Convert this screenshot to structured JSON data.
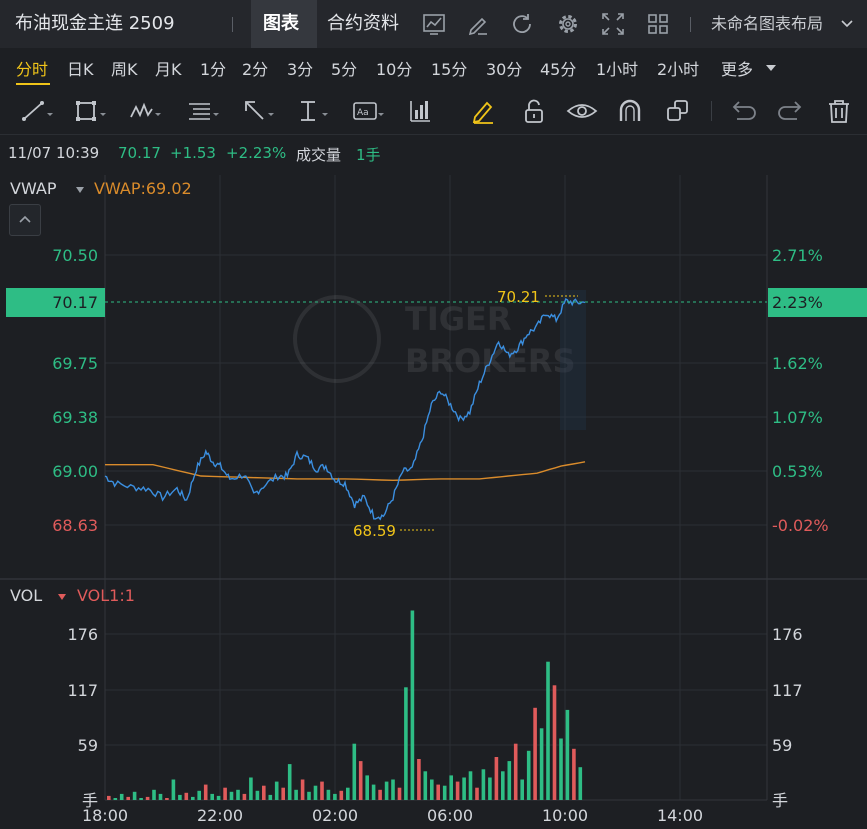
{
  "header": {
    "symbol": "布油现金主连 2509",
    "tab_chart": "图表",
    "tab_contract": "合约资料",
    "layout_name": "未命名图表布局"
  },
  "periods": [
    "分时",
    "日K",
    "周K",
    "月K",
    "1分",
    "2分",
    "3分",
    "5分",
    "10分",
    "15分",
    "30分",
    "45分",
    "1小时",
    "2小时"
  ],
  "active_period": "分时",
  "more_label": "更多",
  "icons": {
    "header": [
      "indicator-chart-icon",
      "draw-edit-icon",
      "refresh-icon",
      "gear-icon",
      "fullscreen-icon",
      "grid-layout-icon",
      "chevron-down-icon"
    ],
    "tools": [
      "trend-line-icon",
      "rectangle-icon",
      "pattern-icon",
      "fib-icon",
      "arrow-icon",
      "measure-icon",
      "text-note-icon",
      "volume-profile-icon",
      "highlighter-icon",
      "unlock-icon",
      "eye-icon",
      "magnet-icon",
      "clone-icon",
      "undo-icon",
      "redo-icon",
      "trash-icon"
    ]
  },
  "colors": {
    "up": "#2ebd85",
    "down": "#e05b5b",
    "accent": "#f0c419",
    "vwap": "#d98b2b",
    "price": "#3b8fe0",
    "current_tag": "#2ebd85"
  },
  "info": {
    "datetime": "11/07 10:39",
    "price": "70.17",
    "change": "+1.53",
    "change_pct": "+2.23%",
    "vol_label": "成交量",
    "vol_value": "1手"
  },
  "chart_data": [
    {
      "type": "line",
      "indicator": "VWAP",
      "indicator_value": "VWAP:69.02",
      "x_ticks": [
        "18:00",
        "22:00",
        "02:00",
        "06:00",
        "10:00",
        "14:00"
      ],
      "y_ticks": [
        "70.50",
        "69.75",
        "69.38",
        "69.00",
        "68.63"
      ],
      "y_ticks_right": [
        "2.71%",
        "1.62%",
        "1.07%",
        "0.53%",
        "-0.02%"
      ],
      "current_price": "70.17",
      "current_pct": "2.23%",
      "high_label": "70.21",
      "low_label": "68.59",
      "ylim": [
        68.43,
        70.68
      ],
      "series": [
        {
          "x": [
            0,
            0.02,
            0.06,
            0.09,
            0.12,
            0.15,
            0.17,
            0.19,
            0.21,
            0.225,
            0.24,
            0.26,
            0.29,
            0.31,
            0.33,
            0.36,
            0.38,
            0.4,
            0.42,
            0.44,
            0.46,
            0.48,
            0.5,
            0.52,
            0.54,
            0.56,
            0.58,
            0.6,
            0.62,
            0.64,
            0.66,
            0.68,
            0.7,
            0.72,
            0.74,
            0.76,
            0.78,
            0.8,
            0.82,
            0.84,
            0.86,
            0.88,
            0.9,
            0.92,
            0.94,
            0.96,
            0.98,
            1.0
          ],
          "y": [
            68.95,
            68.9,
            68.87,
            68.86,
            68.8,
            68.86,
            68.78,
            69.0,
            69.12,
            69.05,
            69.02,
            68.93,
            68.96,
            68.82,
            68.88,
            68.95,
            68.95,
            69.1,
            69.08,
            69.0,
            69.02,
            68.92,
            68.9,
            68.75,
            68.8,
            68.67,
            68.67,
            68.8,
            68.98,
            69.0,
            69.2,
            69.45,
            69.55,
            69.45,
            69.35,
            69.4,
            69.6,
            69.75,
            69.9,
            69.8,
            69.85,
            69.95,
            70.0,
            70.1,
            70.05,
            70.18,
            70.17,
            70.17
          ]
        },
        {
          "x": [
            0,
            0.1,
            0.2,
            0.3,
            0.4,
            0.5,
            0.6,
            0.7,
            0.78,
            0.84,
            0.9,
            0.95,
            1.0
          ],
          "y": [
            69.03,
            69.03,
            68.95,
            68.94,
            68.93,
            68.93,
            68.92,
            68.93,
            68.93,
            68.95,
            68.97,
            69.02,
            69.05
          ]
        }
      ]
    },
    {
      "type": "bar",
      "indicator": "VOL",
      "indicator_value": "VOL1:1",
      "y_ticks": [
        "176",
        "117",
        "59",
        "手"
      ],
      "ylim": [
        0,
        205
      ],
      "values": [
        4,
        2,
        6,
        3,
        8,
        2,
        3,
        10,
        6,
        2,
        20,
        5,
        7,
        3,
        9,
        15,
        6,
        4,
        12,
        8,
        10,
        6,
        22,
        9,
        14,
        5,
        18,
        12,
        35,
        10,
        20,
        8,
        14,
        18,
        10,
        6,
        9,
        12,
        55,
        38,
        24,
        15,
        10,
        18,
        20,
        12,
        110,
        185,
        40,
        28,
        20,
        15,
        14,
        24,
        18,
        22,
        28,
        12,
        30,
        22,
        42,
        28,
        38,
        55,
        20,
        48,
        90,
        70,
        135,
        112,
        60,
        88,
        50,
        32
      ]
    }
  ]
}
